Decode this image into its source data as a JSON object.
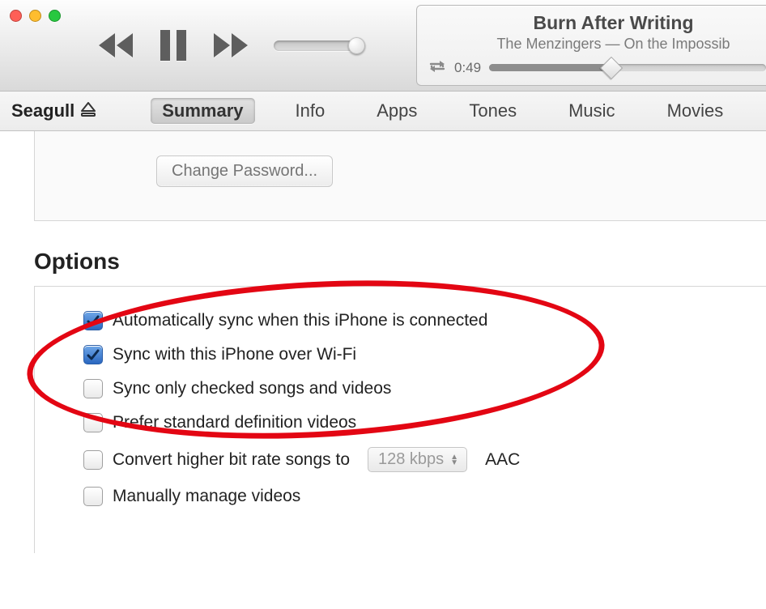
{
  "nowPlaying": {
    "title": "Burn After Writing",
    "subtitle": "The Menzingers — On the Impossib",
    "elapsed": "0:49"
  },
  "device": {
    "name": "Seagull"
  },
  "tabs": {
    "summary": "Summary",
    "info": "Info",
    "apps": "Apps",
    "tones": "Tones",
    "music": "Music",
    "movies": "Movies"
  },
  "buttons": {
    "changePassword": "Change Password..."
  },
  "sections": {
    "options": "Options"
  },
  "options": {
    "autoSync": "Automatically sync when this iPhone is connected",
    "wifiSync": "Sync with this iPhone over Wi-Fi",
    "onlyChecked": "Sync only checked songs and videos",
    "preferSD": "Prefer standard definition videos",
    "convertBitrate": "Convert higher bit rate songs to",
    "convertUnit": "AAC",
    "bitrateValue": "128 kbps",
    "manualVideos": "Manually manage videos"
  },
  "checked": {
    "autoSync": true,
    "wifiSync": true,
    "onlyChecked": false,
    "preferSD": false,
    "convertBitrate": false,
    "manualVideos": false
  }
}
